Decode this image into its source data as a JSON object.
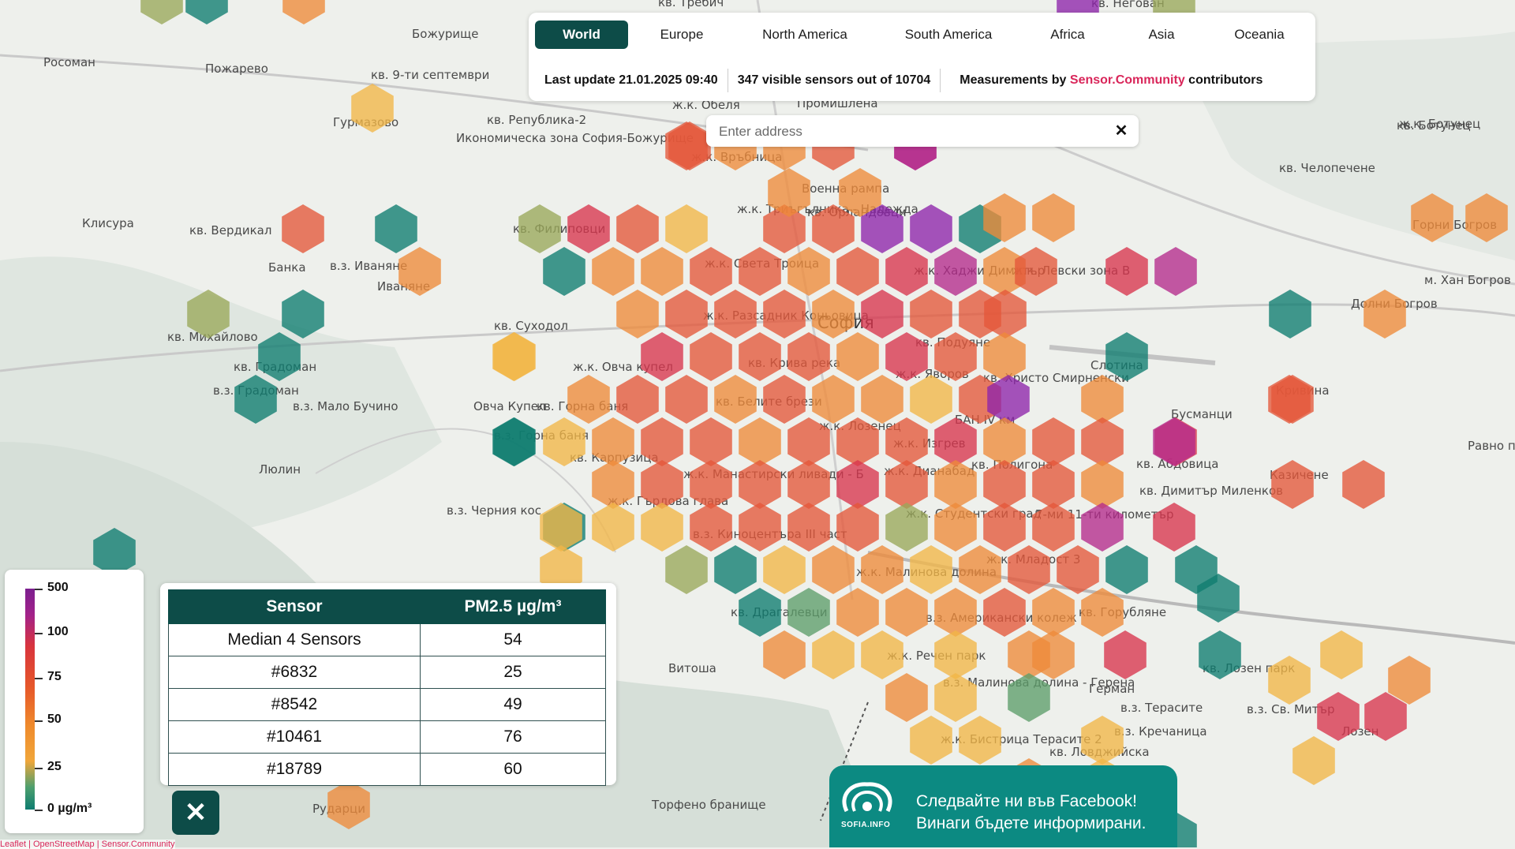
{
  "tabs": [
    {
      "label": "World",
      "active": true
    },
    {
      "label": "Europe"
    },
    {
      "label": "North America"
    },
    {
      "label": "South America"
    },
    {
      "label": "Africa"
    },
    {
      "label": "Asia"
    },
    {
      "label": "Oceania"
    }
  ],
  "status": {
    "last_update": "Last update 21.01.2025 09:40",
    "visible_count": "347",
    "visible_text": "visible sensors out of",
    "total": "10704",
    "measurements_prefix": "Measurements by",
    "source_link": "Sensor.Community",
    "measurements_suffix": "contributors"
  },
  "search": {
    "placeholder": "Enter address",
    "clear_icon": "close-icon"
  },
  "legend": {
    "labels": [
      "500",
      "100",
      "75",
      "50",
      "25",
      "0 µg/m³"
    ]
  },
  "sensor_table": {
    "headers": [
      "Sensor",
      "PM2.5 µg/m³"
    ],
    "rows": [
      [
        "Median 4 Sensors",
        "54"
      ],
      [
        "#6832",
        "25"
      ],
      [
        "#8542",
        "49"
      ],
      [
        "#10461",
        "76"
      ],
      [
        "#18789",
        "60"
      ]
    ]
  },
  "close_button": {
    "icon": "close-icon",
    "symbol": "✕"
  },
  "facebook_banner": {
    "line1": "Следвайте ни във Facebook!",
    "line2": "Винаги бъдете информирани.",
    "logo_text": "SOFIA.INFO"
  },
  "attribution": "Leaflet | OpenStreetMap | Sensor.Community",
  "colors": {
    "teal": "#0e7c70",
    "green": "#5d9e6a",
    "olive": "#9aa85a",
    "yellow": "#f2b646",
    "orange": "#ee8a3a",
    "red_orange": "#e4573a",
    "red": "#d8344d",
    "magenta": "#b52a8c",
    "purple": "#8e24aa",
    "brand": "#0d4c48",
    "accent": "#d9265a"
  },
  "map": {
    "labels": [
      "Божурище",
      "Пожарево",
      "Росоман",
      "Гурмазово",
      "кв. 9-ти септември",
      "кв. Република-2",
      "Клисура",
      "кв. Вердикал",
      "Банка",
      "в.з. Иванянe",
      "Иваняне",
      "кв. Михайлово",
      "кв. Градоман",
      "в.з. Градоман",
      "в.з. Мало Бучино",
      "Люлин",
      "в.з. Черния кос",
      "кв. Филиповци",
      "кв. Суходол",
      "ж.к. Овча купел",
      "кв. Горна баня",
      "в.з. Горна баня",
      "кв. Карпузица",
      "ж.к. Гърдова глава",
      "в.з. Киноцентъра III част",
      "кв. Драгалевци",
      "Витоша",
      "Торфено бранище",
      "Рударци",
      "ж.к. Връбница",
      "Военна рампа",
      "ж.к. Триъгълника - Надежда",
      "кв. Орландовци",
      "ж.к. Света Троица",
      "ж.к. Разсадник Коньовица",
      "София",
      "ж.к. Хаджи Димитър",
      "ж.к. Левски зона В",
      "кв. Подуяне",
      "кв. Христо Смирненски",
      "ж.к. Яворов",
      "кв. Белите брези",
      "кв. Кривa река",
      "ж.к. Лозенец",
      "ж.к. Изгрев",
      "БАН IV км",
      "ж.к. Дианабад",
      "кв. Полигона",
      "ж.к. Манастирски ливади - Б",
      "ж.к. Студентски град",
      "7-ми 11-ти километър",
      "ж.к. Младост 3",
      "ж.к. Малинова долина",
      "в.з. Американски колеж",
      "кв. Горубляне",
      "ж.к. Речен парк",
      "в.з. Малинова долина - Герена",
      "ж.к. Бистрица Терасите 2",
      "в.з. Терасите",
      "в.з. Кречаницa",
      "кв. Лозен парк",
      "в.з. Св. Митър",
      "Лозен",
      "Герман",
      "кв. Ловджийска",
      "ж.к. Ботунец",
      "кв. Челопечене",
      "Горни Богров",
      "м. Хан Богров",
      "Долни Богров",
      "Кривина",
      "Бусманци",
      "кв. Абдовица",
      "кв. Димитър Миленков",
      "Казичене",
      "Равно поле",
      "Промишлена",
      "ж.к. Обеля",
      "кв. Требич",
      "кв. Ботунец",
      "кв. Негован",
      "Слотина",
      "Овча Купел",
      "Икономическа зона София-Божурище"
    ]
  }
}
